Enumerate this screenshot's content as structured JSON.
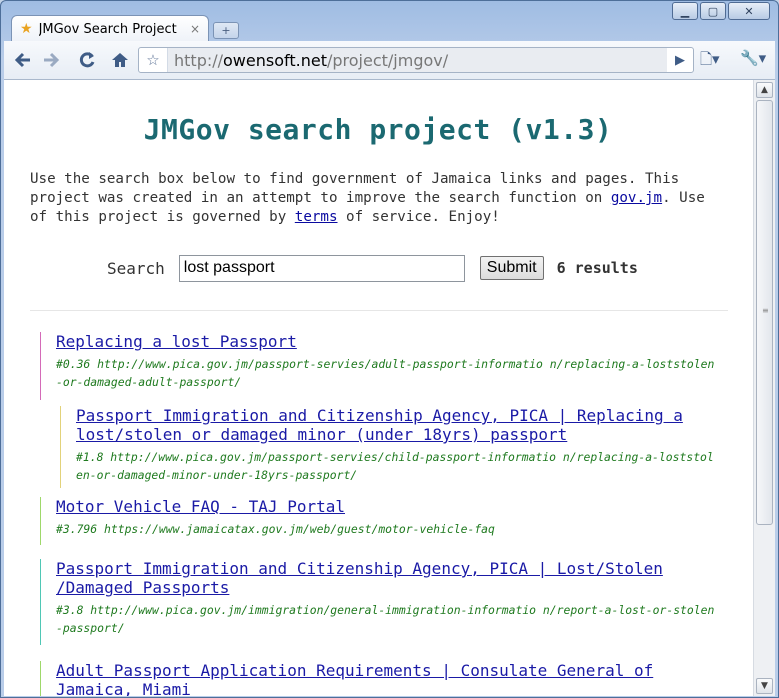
{
  "window": {
    "minimize_label": "▁",
    "maximize_label": "▢",
    "close_label": "✕"
  },
  "tab": {
    "title": "JMGov Search Project",
    "close_label": "×",
    "new_tab_label": "+"
  },
  "toolbar": {
    "url_prefix": "http://",
    "url_host": "owensoft.net",
    "url_path": "/project/jmgov/"
  },
  "page": {
    "title": "JMGov search project (v1.3)",
    "intro_1": "Use the search box below to find government of Jamaica links and pages. This project was created in an attempt to improve the search function on ",
    "intro_link_1": "gov.jm",
    "intro_2": ". Use of this project is governed by ",
    "intro_link_2": "terms",
    "intro_3": " of service. Enjoy!",
    "search_label": "Search",
    "search_value": "lost passport",
    "submit_label": "Submit",
    "result_count": "6 results"
  },
  "results": [
    {
      "title": "Replacing a lost Passport",
      "meta": "#0.36 http://www.pica.gov.jm/passport-servies/adult-passport-informatio n/replacing-a-loststolen-or-damaged-adult-passport/",
      "bar_color": "#d46ab8"
    },
    {
      "title": "Passport Immigration and Citizenship Agency, PICA | Replacing a lost/stolen or damaged minor (under 18yrs) passport",
      "meta": "#1.8 http://www.pica.gov.jm/passport-servies/child-passport-informatio n/replacing-a-loststolen-or-damaged-minor-under-18yrs-passport/",
      "bar_color": "#e2d27a"
    },
    {
      "title": "Motor Vehicle FAQ - TAJ Portal",
      "meta": "#3.796 https://www.jamaicatax.gov.jm/web/guest/motor-vehicle-faq",
      "bar_color": "#9ed86a"
    },
    {
      "title": "Passport Immigration and Citizenship Agency, PICA | Lost/Stolen /Damaged Passports",
      "meta": "#3.8 http://www.pica.gov.jm/immigration/general-immigration-informatio n/report-a-lost-or-stolen-passport/",
      "bar_color": "#4fc7b5"
    },
    {
      "title": "Adult Passport Application Requirements | Consulate General of Jamaica, Miami",
      "meta": "",
      "bar_color": "#9ed86a"
    }
  ]
}
